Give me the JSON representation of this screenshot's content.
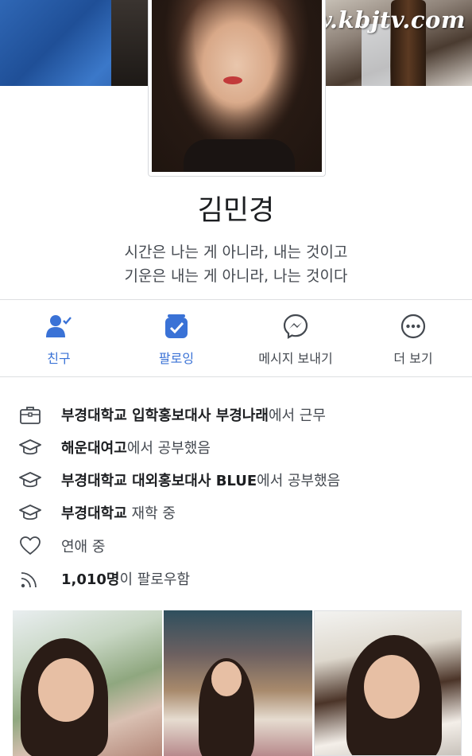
{
  "watermark": "www.kbjtv.com",
  "profile": {
    "name": "김민경",
    "bio_line1": "시간은 나는 게 아니라, 내는 것이고",
    "bio_line2": "기운은 내는 게 아니라, 나는 것이다"
  },
  "actions": [
    {
      "label": "친구",
      "icon": "friend-check-icon",
      "active": true
    },
    {
      "label": "팔로잉",
      "icon": "following-check-icon",
      "active": true
    },
    {
      "label": "메시지 보내기",
      "icon": "messenger-icon",
      "active": false
    },
    {
      "label": "더 보기",
      "icon": "more-dots-icon",
      "active": false
    }
  ],
  "info": [
    {
      "icon": "briefcase-icon",
      "bold1": "부경대학교 입학홍보대사 부경나래",
      "text1": "에서 근무"
    },
    {
      "icon": "graduation-cap-icon",
      "bold1": "해운대여고",
      "text1": "에서 공부했음"
    },
    {
      "icon": "graduation-cap-icon",
      "bold1": "부경대학교 대외홍보대사 BLUE",
      "text1": "에서 공부했음"
    },
    {
      "icon": "graduation-cap-icon",
      "bold1": "부경대학교",
      "text1": " 재학 중"
    },
    {
      "icon": "heart-icon",
      "bold1": "",
      "text1": "연애 중"
    },
    {
      "icon": "feed-icon",
      "bold1": "1,010명",
      "text1": "이 팔로우함"
    }
  ],
  "colors": {
    "accent": "#3a72d6",
    "text_secondary": "#444950",
    "divider": "#dddfe2"
  }
}
